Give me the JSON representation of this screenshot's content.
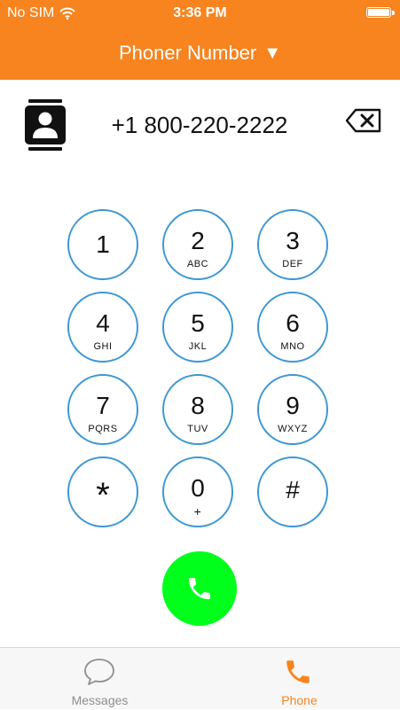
{
  "status_bar": {
    "carrier": "No SIM",
    "time": "3:36 PM"
  },
  "header": {
    "title": "Phoner Number",
    "dropdown_glyph": "▼",
    "background_color": "#f7841f"
  },
  "dialer": {
    "number": "+1 800-220-2222",
    "contacts_icon": "contact-card-icon",
    "backspace_icon": "backspace-icon"
  },
  "keypad": {
    "keys": [
      {
        "digit": "1",
        "letters": ""
      },
      {
        "digit": "2",
        "letters": "ABC"
      },
      {
        "digit": "3",
        "letters": "DEF"
      },
      {
        "digit": "4",
        "letters": "GHI"
      },
      {
        "digit": "5",
        "letters": "JKL"
      },
      {
        "digit": "6",
        "letters": "MNO"
      },
      {
        "digit": "7",
        "letters": "PQRS"
      },
      {
        "digit": "8",
        "letters": "TUV"
      },
      {
        "digit": "9",
        "letters": "WXYZ"
      },
      {
        "digit": "*",
        "letters": ""
      },
      {
        "digit": "0",
        "letters": "+"
      },
      {
        "digit": "#",
        "letters": ""
      }
    ],
    "ring_color": "#3d97d4"
  },
  "call_button": {
    "icon": "phone-handset-icon",
    "color": "#00ff1a"
  },
  "tab_bar": {
    "tabs": [
      {
        "label": "Messages",
        "icon": "speech-bubble-icon",
        "active": false
      },
      {
        "label": "Phone",
        "icon": "phone-handset-icon",
        "active": true
      }
    ],
    "active_color": "#f7841f",
    "inactive_color": "#8e8e93"
  }
}
